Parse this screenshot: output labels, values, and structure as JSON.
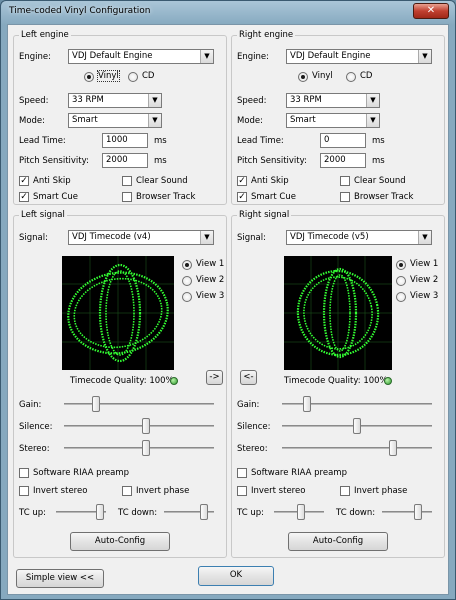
{
  "window": {
    "title": "Time-coded Vinyl Configuration",
    "close_glyph": "✕"
  },
  "left_engine": {
    "group_title": "Left engine",
    "engine_label": "Engine:",
    "engine_value": "VDJ Default Engine",
    "vinyl_label": "Vinyl",
    "cd_label": "CD",
    "speed_label": "Speed:",
    "speed_value": "33 RPM",
    "mode_label": "Mode:",
    "mode_value": "Smart",
    "lead_label": "Lead Time:",
    "lead_value": "1000",
    "lead_unit": "ms",
    "pitch_label": "Pitch Sensitivity:",
    "pitch_value": "2000",
    "pitch_unit": "ms",
    "anti_skip": "Anti Skip",
    "smart_cue": "Smart Cue",
    "clear_sound": "Clear Sound",
    "browser_track": "Browser Track"
  },
  "right_engine": {
    "group_title": "Right engine",
    "engine_label": "Engine:",
    "engine_value": "VDJ Default Engine",
    "vinyl_label": "Vinyl",
    "cd_label": "CD",
    "speed_label": "Speed:",
    "speed_value": "33 RPM",
    "mode_label": "Mode:",
    "mode_value": "Smart",
    "lead_label": "Lead Time:",
    "lead_value": "0",
    "lead_unit": "ms",
    "pitch_label": "Pitch Sensitivity:",
    "pitch_value": "2000",
    "pitch_unit": "ms",
    "anti_skip": "Anti Skip",
    "smart_cue": "Smart Cue",
    "clear_sound": "Clear Sound",
    "browser_track": "Browser Track"
  },
  "left_signal": {
    "group_title": "Left signal",
    "signal_label": "Signal:",
    "signal_value": "VDJ Timecode (v4)",
    "view1": "View 1",
    "view2": "View 2",
    "view3": "View 3",
    "quality": "Timecode Quality: 100%",
    "arrow_button": "->",
    "gain_label": "Gain:",
    "silence_label": "Silence:",
    "stereo_label": "Stereo:",
    "riaa": "Software RIAA preamp",
    "invert_stereo": "Invert stereo",
    "invert_phase": "Invert phase",
    "tc_up": "TC up:",
    "tc_down": "TC down:",
    "auto_config": "Auto-Config",
    "levels": {
      "gain": 0.2,
      "silence": 0.55,
      "stereo": 0.55,
      "tc_up": 0.95,
      "tc_down": 0.85
    }
  },
  "right_signal": {
    "group_title": "Right signal",
    "signal_label": "Signal:",
    "signal_value": "VDJ Timecode (v5)",
    "view1": "View 1",
    "view2": "View 2",
    "view3": "View 3",
    "quality": "Timecode Quality: 100%",
    "arrow_button": "<-",
    "gain_label": "Gain:",
    "silence_label": "Silence:",
    "stereo_label": "Stereo:",
    "riaa": "Software RIAA preamp",
    "invert_stereo": "Invert stereo",
    "invert_phase": "Invert phase",
    "tc_up": "TC up:",
    "tc_down": "TC down:",
    "auto_config": "Auto-Config",
    "levels": {
      "gain": 0.15,
      "silence": 0.5,
      "stereo": 0.75,
      "tc_up": 0.55,
      "tc_down": 0.75
    }
  },
  "footer": {
    "simple_view": "Simple view <<",
    "ok": "OK"
  },
  "colors": {
    "scope_bg": "#000000",
    "scope_trace": "#33ff33",
    "quality_led": "#2e9a2e"
  }
}
